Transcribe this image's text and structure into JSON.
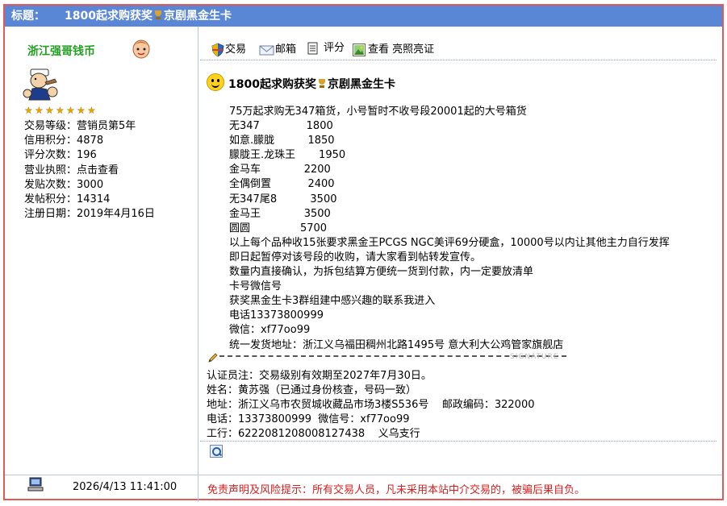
{
  "header": {
    "label": "标题：",
    "title_part1": "1800起求购获奖",
    "title_part2": "京剧黑金生卡"
  },
  "user": {
    "name": "浙江强哥钱币",
    "star_count": 7,
    "info": [
      {
        "key": "交易等级：",
        "value": "营销员第5年"
      },
      {
        "key": "信用积分：",
        "value": "4878"
      },
      {
        "key": "评分次数：",
        "value": "196"
      },
      {
        "key": "营业执照：",
        "value": "点击查看"
      },
      {
        "key": "发贴次数：",
        "value": "3000"
      },
      {
        "key": "发帖积分：",
        "value": "14314"
      },
      {
        "key": "注册日期：",
        "value": "2019年4月16日"
      }
    ]
  },
  "toolbar": {
    "trade": "交易",
    "mail": "邮箱",
    "rate": "评分",
    "view": "查看 亮照亮证"
  },
  "post": {
    "title_part1": "1800起求购获奖",
    "title_part2": "京剧黑金生卡",
    "lines": [
      "75万起求购无347箱货，小号暂时不收号段20001起的大号箱货",
      "无347              1800",
      "如意.朦胧          1850",
      "朦胧王.龙珠王       1950",
      "金马车             2200",
      "全偶倒置           2400",
      "无347尾8          3500",
      "金马王             3500",
      "圆圆               5700",
      "以上每个品种收15张要求黑金王PCGS NGC美评69分硬盒，10000号以内让其他主力自行发挥",
      "即日起暂停对该号段的收购，请大家看到帖转发宣传。",
      "数量内直接确认，为拆包结算方便统一货到付款，内一定要放清单",
      "卡号微信号",
      "获奖黑金生卡3群组建中感兴趣的联系我进入",
      "电话13373800999",
      "微信：xf77oo99",
      "统一发货地址：浙江义乌福田稠州北路1495号 意大利大公鸡管家旗舰店"
    ],
    "signature_mark": "SIGNATURE",
    "cert_lines": [
      "认证员注：交易级别有效期至2027年7月30日。",
      "姓名：黄苏强（已通过身份核查，号码一致）",
      "地址：浙江义乌市农贸城收藏品市场3楼S536号    邮政编码：322000",
      "电话：13373800999  微信号：xf77oo99",
      "工行：6222081208008127438    义乌支行"
    ]
  },
  "footer": {
    "datetime": "2026/4/13 11:41:00",
    "disclaimer": "免责声明及风险提示：所有交易人员，凡未采用本站中介交易的，被骗后果自负。"
  },
  "colors": {
    "titlebar": "#5a86d6",
    "frame": "#e05a5a",
    "username": "#22a022",
    "disclaimer": "#d81e1e"
  }
}
